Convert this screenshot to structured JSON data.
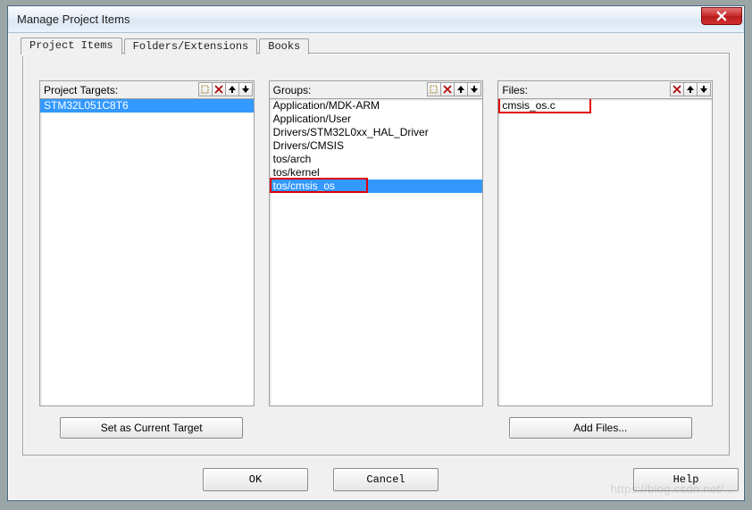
{
  "window": {
    "title": "Manage Project Items"
  },
  "tabs": [
    {
      "label": "Project Items",
      "active": true
    },
    {
      "label": "Folders/Extensions",
      "active": false
    },
    {
      "label": "Books",
      "active": false
    }
  ],
  "panels": {
    "targets": {
      "label": "Project Targets:",
      "items": [
        "STM32L051C8T6"
      ],
      "selected_index": 0,
      "tools": [
        "new-icon",
        "delete-icon",
        "move-up-icon",
        "move-down-icon"
      ]
    },
    "groups": {
      "label": "Groups:",
      "items": [
        "Application/MDK-ARM",
        "Application/User",
        "Drivers/STM32L0xx_HAL_Driver",
        "Drivers/CMSIS",
        "tos/arch",
        "tos/kernel",
        "tos/cmsis_os"
      ],
      "selected_index": 6,
      "tools": [
        "new-icon",
        "delete-icon",
        "move-up-icon",
        "move-down-icon"
      ],
      "redbox_index": 6,
      "redbox_width": 110
    },
    "files": {
      "label": "Files:",
      "items": [
        "cmsis_os.c"
      ],
      "selected_index": -1,
      "tools": [
        "delete-icon",
        "move-up-icon",
        "move-down-icon"
      ],
      "redbox_index": 0,
      "redbox_width": 104
    }
  },
  "buttons": {
    "set_current": "Set as Current Target",
    "add_files": "Add Files...",
    "ok": "OK",
    "cancel": "Cancel",
    "help": "Help"
  },
  "watermark": "https://blog.csdn.net/..."
}
